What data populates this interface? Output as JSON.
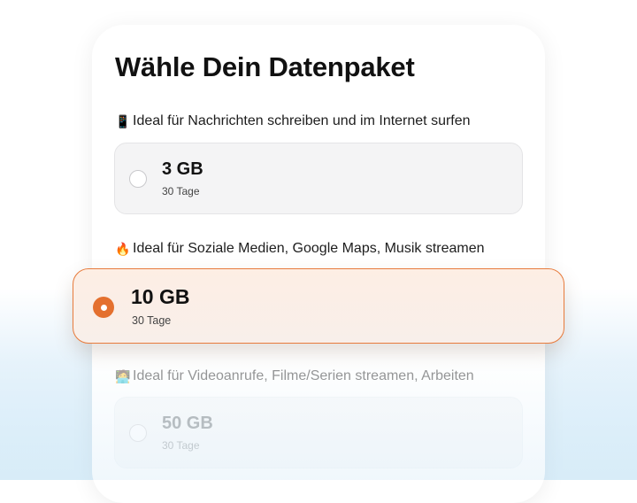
{
  "title": "Wähle Dein Datenpaket",
  "colors": {
    "accent": "#e4702f",
    "selected_bg": "#fdeee4",
    "card_bg": "#ffffff"
  },
  "categories": [
    {
      "icon": "mobile-phone-icon",
      "icon_glyph": "📱",
      "label": "Ideal für Nachrichten schreiben und im Internet surfen"
    },
    {
      "icon": "fire-icon",
      "icon_glyph": "🔥",
      "label": "Ideal für Soziale Medien, Google Maps, Musik streamen"
    },
    {
      "icon": "laptop-person-icon",
      "icon_glyph": "🧑‍💻",
      "label": "Ideal für Videoanrufe, Filme/Serien streamen, Arbeiten"
    }
  ],
  "options": [
    {
      "size": "3 GB",
      "duration": "30 Tage",
      "selected": false
    },
    {
      "size": "10 GB",
      "duration": "30 Tage",
      "selected": true
    },
    {
      "size": "50 GB",
      "duration": "30 Tage",
      "selected": false
    }
  ]
}
